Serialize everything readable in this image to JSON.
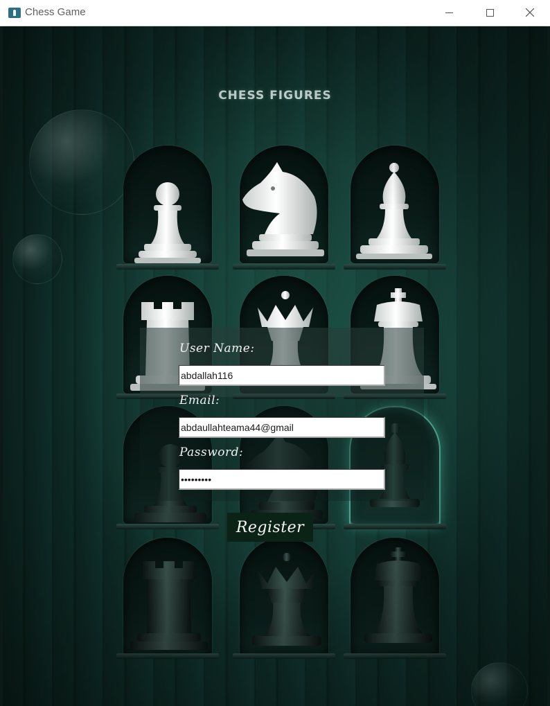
{
  "window": {
    "title": "Chess Game"
  },
  "headline": "CHESS FIGURES",
  "form": {
    "username_label": "User Name:",
    "username_value": "abdallah116",
    "email_label": "Email:",
    "email_value": "abdaullahteama44@gmail",
    "password_label": "Password:",
    "password_value": "•••••••••",
    "register_label": "Register"
  },
  "colors": {
    "background": "#0b221e",
    "white_piece": "#e9ecea",
    "black_piece": "#1b2a27",
    "accent_glow": "#5ad6bc",
    "button_bg": "#0b2316"
  },
  "pieces": [
    {
      "name": "white-pawn",
      "color": "white"
    },
    {
      "name": "white-knight",
      "color": "white"
    },
    {
      "name": "white-bishop",
      "color": "white"
    },
    {
      "name": "white-rook",
      "color": "white"
    },
    {
      "name": "white-queen",
      "color": "white"
    },
    {
      "name": "white-king",
      "color": "white"
    },
    {
      "name": "black-pawn",
      "color": "black"
    },
    {
      "name": "black-knight",
      "color": "black"
    },
    {
      "name": "black-bishop",
      "color": "black"
    },
    {
      "name": "black-rook",
      "color": "black"
    },
    {
      "name": "black-queen",
      "color": "black"
    },
    {
      "name": "black-king",
      "color": "black"
    }
  ]
}
